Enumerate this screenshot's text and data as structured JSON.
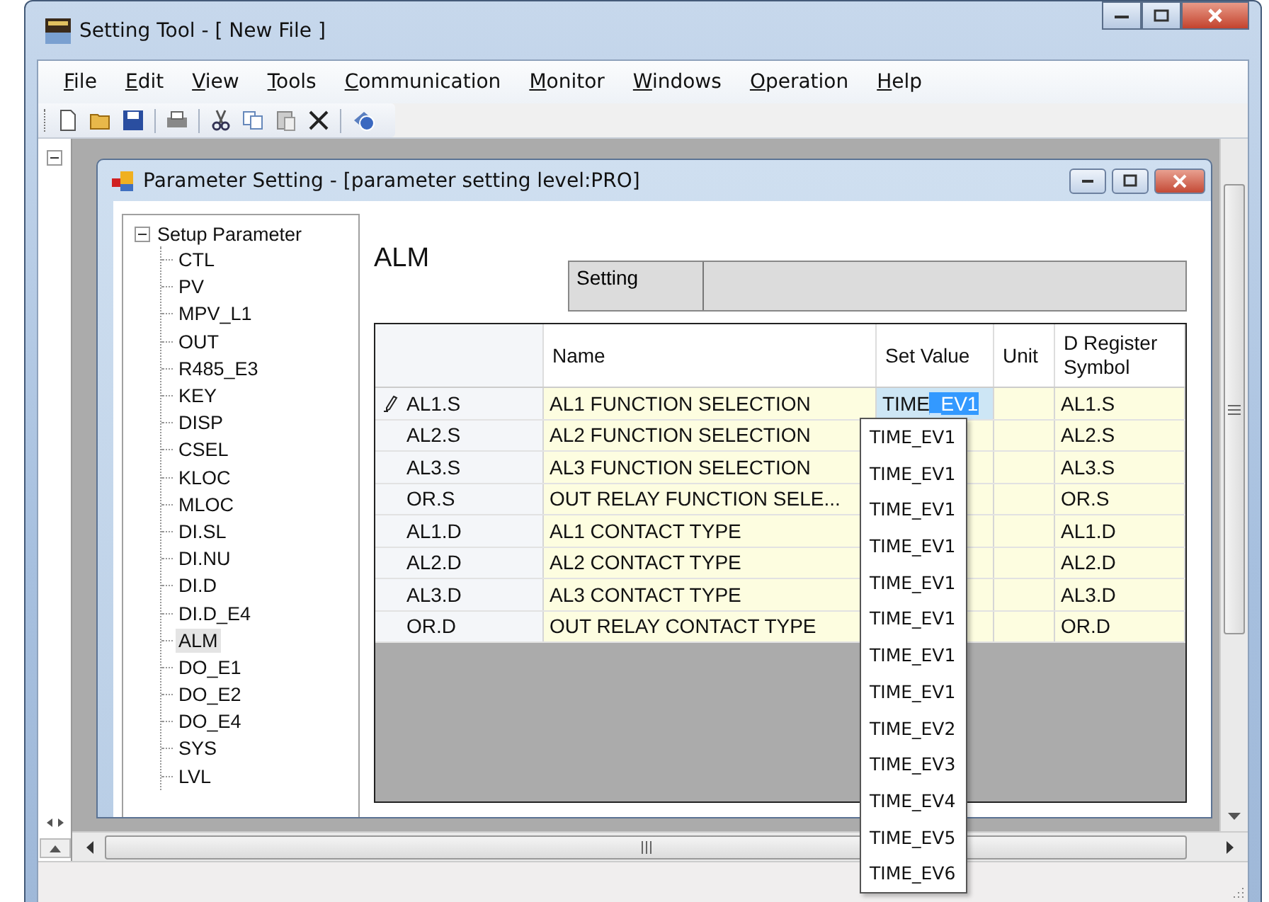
{
  "window": {
    "title": "Setting Tool - [ New File ]"
  },
  "menu": [
    {
      "label": "File"
    },
    {
      "label": "Edit"
    },
    {
      "label": "View"
    },
    {
      "label": "Tools"
    },
    {
      "label": "Communication"
    },
    {
      "label": "Monitor"
    },
    {
      "label": "Windows"
    },
    {
      "label": "Operation"
    },
    {
      "label": "Help"
    }
  ],
  "side_tree": {
    "expanded": true
  },
  "child_window": {
    "title": "Parameter Setting - [parameter setting level:PRO]",
    "tree": {
      "label": "Setup Parameter",
      "expanded": true,
      "children": [
        {
          "label": "CTL",
          "selected": false
        },
        {
          "label": "PV",
          "selected": false
        },
        {
          "label": "MPV_L1",
          "selected": false
        },
        {
          "label": "OUT",
          "selected": false
        },
        {
          "label": "R485_E3",
          "selected": false
        },
        {
          "label": "KEY",
          "selected": false
        },
        {
          "label": "DISP",
          "selected": false
        },
        {
          "label": "CSEL",
          "selected": false
        },
        {
          "label": "KLOC",
          "selected": false
        },
        {
          "label": "MLOC",
          "selected": false
        },
        {
          "label": "DI.SL",
          "selected": false
        },
        {
          "label": "DI.NU",
          "selected": false
        },
        {
          "label": "DI.D",
          "selected": false
        },
        {
          "label": "DI.D_E4",
          "selected": false
        },
        {
          "label": "ALM",
          "selected": true
        },
        {
          "label": "DO_E1",
          "selected": false
        },
        {
          "label": "DO_E2",
          "selected": false
        },
        {
          "label": "DO_E4",
          "selected": false
        },
        {
          "label": "SYS",
          "selected": false
        },
        {
          "label": "LVL",
          "selected": false
        }
      ]
    },
    "heading": "ALM",
    "setting": {
      "label": "Setting"
    },
    "grid": {
      "columns": [
        "Name",
        "Set Value",
        "Unit",
        "D Register Symbol"
      ],
      "rows": [
        {
          "header": "AL1.S",
          "editing": true,
          "name": "AL1 FUNCTION SELECTION",
          "set_value": {
            "text": "TIME",
            "selected_text": "_EV1"
          },
          "d_register": "AL1.S"
        },
        {
          "header": "AL2.S",
          "editing": false,
          "name": "AL2 FUNCTION SELECTION",
          "d_register": "AL2.S"
        },
        {
          "header": "AL3.S",
          "editing": false,
          "name": "AL3 FUNCTION SELECTION",
          "d_register": "AL3.S"
        },
        {
          "header": "OR.S",
          "editing": false,
          "name": "OUT RELAY FUNCTION SELE...",
          "d_register": "OR.S"
        },
        {
          "header": "AL1.D",
          "editing": false,
          "name": "AL1 CONTACT TYPE",
          "d_register": "AL1.D"
        },
        {
          "header": "AL2.D",
          "editing": false,
          "name": "AL2 CONTACT TYPE",
          "d_register": "AL2.D"
        },
        {
          "header": "AL3.D",
          "editing": false,
          "name": "AL3 CONTACT TYPE",
          "d_register": "AL3.D"
        },
        {
          "header": "OR.D",
          "editing": false,
          "name": "OUT RELAY CONTACT TYPE",
          "d_register": "OR.D"
        }
      ]
    },
    "dropdown": {
      "options": [
        "TIME_EV1",
        "TIME_EV1",
        "TIME_EV1",
        "TIME_EV1",
        "TIME_EV1",
        "TIME_EV1",
        "TIME_EV1",
        "TIME_EV1",
        "TIME_EV2",
        "TIME_EV3",
        "TIME_EV4",
        "TIME_EV5",
        "TIME_EV6"
      ]
    }
  }
}
